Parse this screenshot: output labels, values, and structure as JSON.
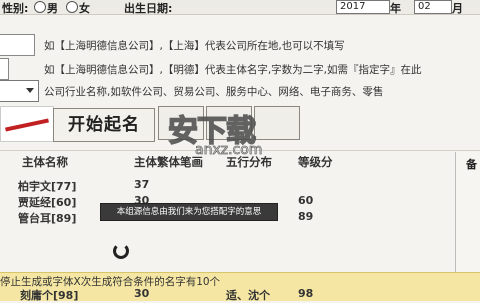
{
  "top": {
    "label1": "性别:",
    "opt1": "男",
    "opt2": "女",
    "label2": "出生日期:",
    "year": "2017",
    "year_unit": "年",
    "month": "02",
    "month_unit": "月"
  },
  "hints": {
    "h1": "如【上海明德信息公司】,【上海】代表公司所在地,也可以不填写",
    "h2": "如【上海明德信息公司】,【明德】代表主体名字,字数为二字,如需『指定字』在此",
    "h3": "公司行业名称,如软件公司、贸易公司、服务中心、网络、电子商务、零售"
  },
  "buttons": {
    "start": "开始起名"
  },
  "headers": [
    "主体名称",
    "主体繁体笔画",
    "五行分布",
    "等级分"
  ],
  "rows": [
    {
      "name": "柏宇文[77]",
      "strokes": "37",
      "wx": "",
      "score": ""
    },
    {
      "name": "贾延经[60]",
      "strokes": "30",
      "wx": "",
      "score": "60"
    },
    {
      "name": "管台耳[89]",
      "strokes": "",
      "wx": "",
      "score": "89"
    },
    {
      "name": "",
      "strokes": "",
      "wx": "",
      "score": ""
    }
  ],
  "tooltip": "本组源信息由我们来为您搭配字的意思",
  "right_header": "备",
  "status": {
    "line1": "停止生成或字体X次生成符合条件的名字有10个",
    "r_name": "刻庸个[98]",
    "r_strokes": "30",
    "r_wx": "适、沈个",
    "r_score": "98"
  },
  "watermark": {
    "main": "安下载",
    "sub": "anxz.com"
  }
}
